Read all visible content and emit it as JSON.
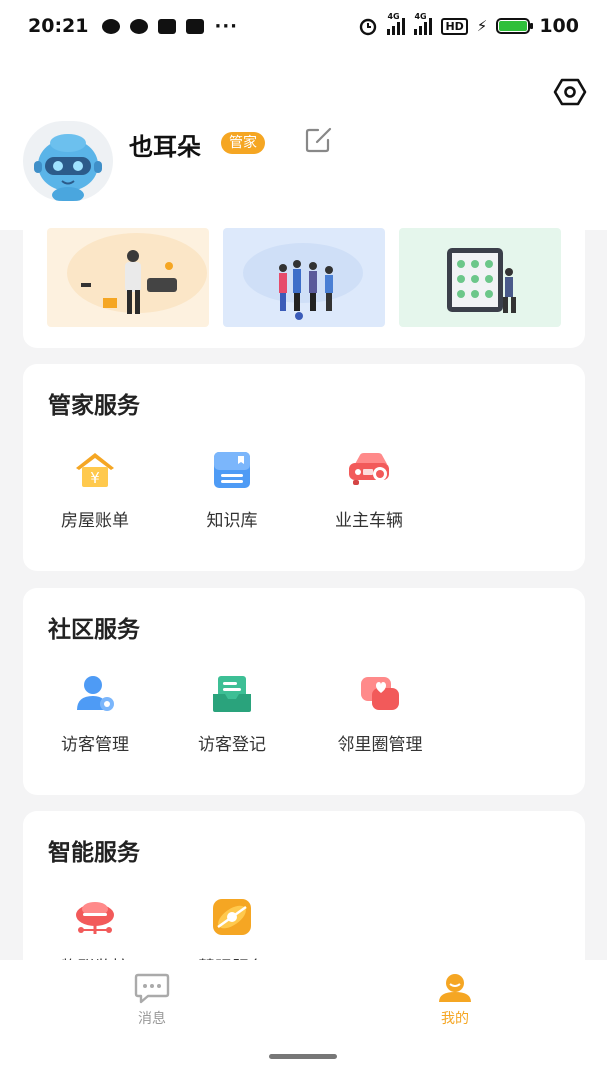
{
  "status_bar": {
    "time": "20:21",
    "network_a": "4G",
    "network_b": "4G",
    "hd_label": "HD",
    "battery": "100",
    "battery_level": 1.0,
    "battery_color": "#2fbf3a"
  },
  "profile": {
    "name": "也耳朵",
    "role_badge": "管家",
    "badge_color": "#f5a623"
  },
  "icons": {
    "settings": "settings-icon",
    "edit": "edit-icon"
  },
  "sections": [
    {
      "title": "管家服务",
      "items": [
        {
          "label": "房屋账单",
          "icon": "house-bill-icon"
        },
        {
          "label": "知识库",
          "icon": "knowledge-base-icon"
        },
        {
          "label": "业主车辆",
          "icon": "car-icon"
        }
      ]
    },
    {
      "title": "社区服务",
      "items": [
        {
          "label": "访客管理",
          "icon": "visitor-management-icon"
        },
        {
          "label": "访客登记",
          "icon": "visitor-register-icon"
        },
        {
          "label": "邻里圈管理",
          "icon": "neighborhood-icon"
        }
      ]
    },
    {
      "title": "智能服务",
      "items": [
        {
          "label": "物联监控",
          "icon": "iot-monitor-icon"
        },
        {
          "label": "慧眼服务",
          "icon": "smart-eye-icon"
        }
      ]
    }
  ],
  "tabs": [
    {
      "label": "消息",
      "icon": "message-icon",
      "active": false
    },
    {
      "label": "我的",
      "icon": "profile-icon",
      "active": true
    }
  ],
  "colors": {
    "accent": "#f5a623",
    "tab_inactive": "#999999"
  }
}
